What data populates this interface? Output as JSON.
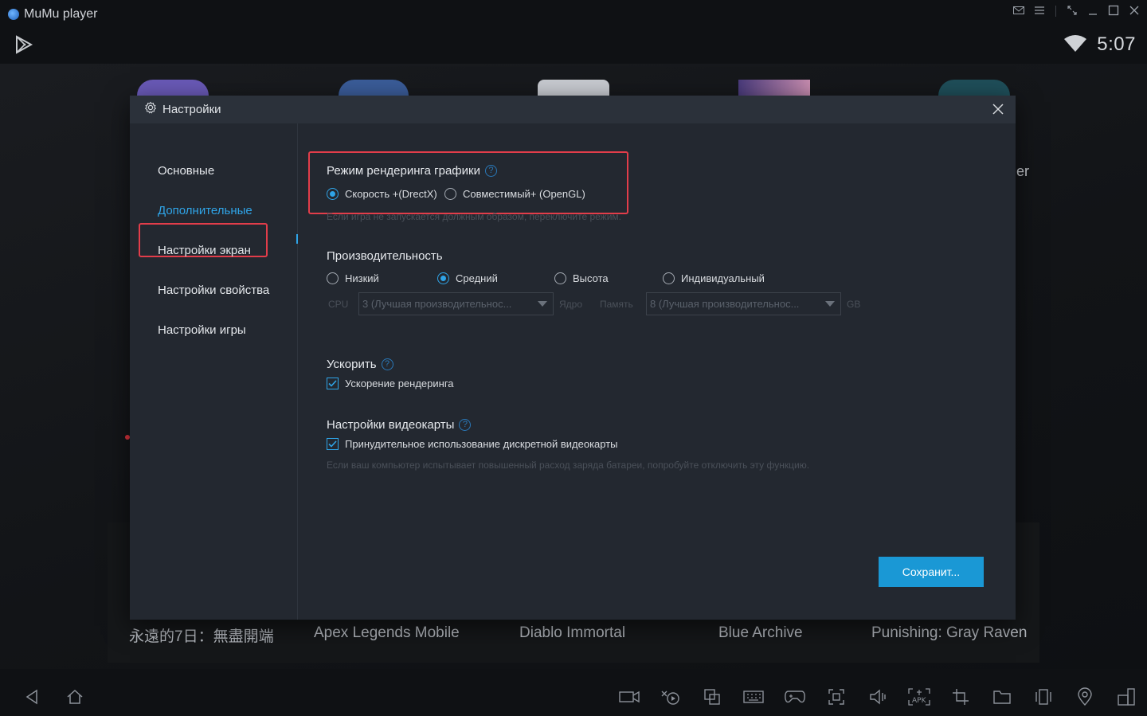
{
  "window": {
    "title": "MuMu player",
    "icons": [
      "mail-icon",
      "menu-icon",
      "expand-icon",
      "minimize-icon",
      "maximize-icon",
      "close-icon"
    ]
  },
  "status_bar": {
    "time": "5:07"
  },
  "background": {
    "peek_text": "er",
    "games": [
      "永遠的7日：無盡開端",
      "Apex Legends Mobile",
      "Diablo Immortal",
      "Blue Archive",
      "Punishing: Gray Raven"
    ]
  },
  "dialog": {
    "title": "Настройки",
    "sidebar": {
      "items": [
        {
          "label": "Основные"
        },
        {
          "label": "Дополнительные",
          "active": true
        },
        {
          "label": "Настройки экран"
        },
        {
          "label": "Настройки свойства"
        },
        {
          "label": "Настройки игры"
        }
      ]
    },
    "render": {
      "title": "Режим рендеринга графики",
      "options": [
        "Скорость +(DrectX)",
        "Совместимый+ (OpenGL)"
      ],
      "selected": "Скорость +(DrectX)",
      "hint": "Если игра не запускается должным образом, переключите режим."
    },
    "performance": {
      "title": "Производительность",
      "options": [
        "Низкий",
        "Средний",
        "Высота",
        "Индивидуальный"
      ],
      "selected": "Средний",
      "cpu_label": "CPU",
      "cpu_value": "3 (Лучшая производительнос...",
      "core_label": "Ядро",
      "memory_label": "Память",
      "memory_value": "8 (Лучшая производительнос...",
      "memory_unit": "GB"
    },
    "accelerate": {
      "title": "Ускорить",
      "checkbox_label": "Ускорение рендеринга",
      "checked": true
    },
    "gpu": {
      "title": "Настройки видеокарты",
      "checkbox_label": "Принудительное использование дискретной видеокарты",
      "checked": true,
      "hint": "Если ваш компьютер испытывает повышенный расход заряда батареи, попробуйте отключить эту функцию."
    },
    "save_label": "Сохранит..."
  },
  "colors": {
    "accent": "#2fa4e7",
    "highlight": "#e23d4a",
    "button": "#1a98d5"
  }
}
